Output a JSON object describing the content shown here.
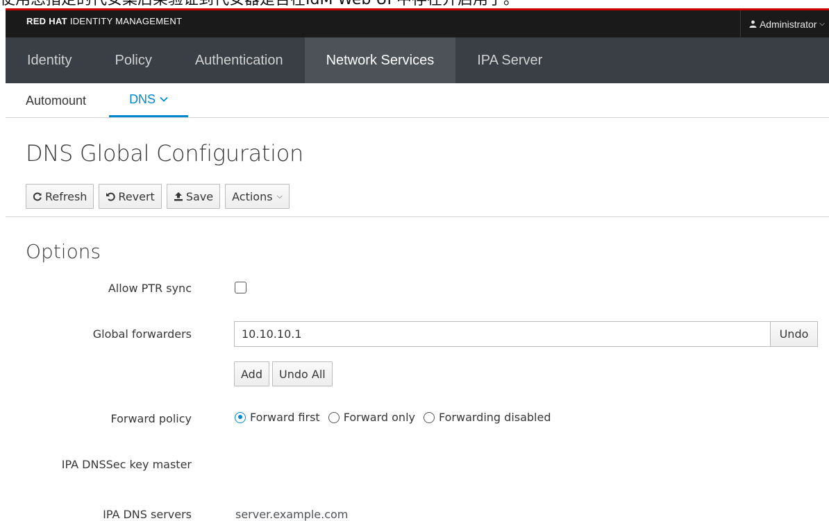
{
  "caption": "使用您指定的代安集后架验证到代安器是否在IdM Web UI 中存在并启用了。",
  "masthead": {
    "brand_strong": "RED HAT",
    "brand_rest": " IDENTITY MANAGEMENT",
    "user": "Administrator",
    "accent_color": "#cc0000"
  },
  "nav_primary": {
    "tabs": [
      {
        "label": "Identity"
      },
      {
        "label": "Policy"
      },
      {
        "label": "Authentication"
      },
      {
        "label": "Network Services",
        "active": true
      },
      {
        "label": "IPA Server"
      }
    ]
  },
  "nav_secondary": {
    "tabs": [
      {
        "label": "Automount"
      },
      {
        "label": "DNS",
        "active": true
      }
    ],
    "accent_color": "#0088ce"
  },
  "page": {
    "title": "DNS Global Configuration"
  },
  "toolbar": {
    "refresh": "Refresh",
    "revert": "Revert",
    "save": "Save",
    "actions": "Actions"
  },
  "options": {
    "title": "Options",
    "allow_ptr_sync": {
      "label": "Allow PTR sync",
      "checked": false
    },
    "global_forwarders": {
      "label": "Global forwarders",
      "value": "10.10.10.1",
      "undo": "Undo",
      "add": "Add",
      "undo_all": "Undo All"
    },
    "forward_policy": {
      "label": "Forward policy",
      "options": [
        "Forward first",
        "Forward only",
        "Forwarding disabled"
      ],
      "selected": "Forward first"
    },
    "dnssec_key_master": {
      "label": "IPA DNSSec key master",
      "value": ""
    },
    "dns_servers": {
      "label": "IPA DNS servers",
      "value": "server.example.com"
    }
  }
}
